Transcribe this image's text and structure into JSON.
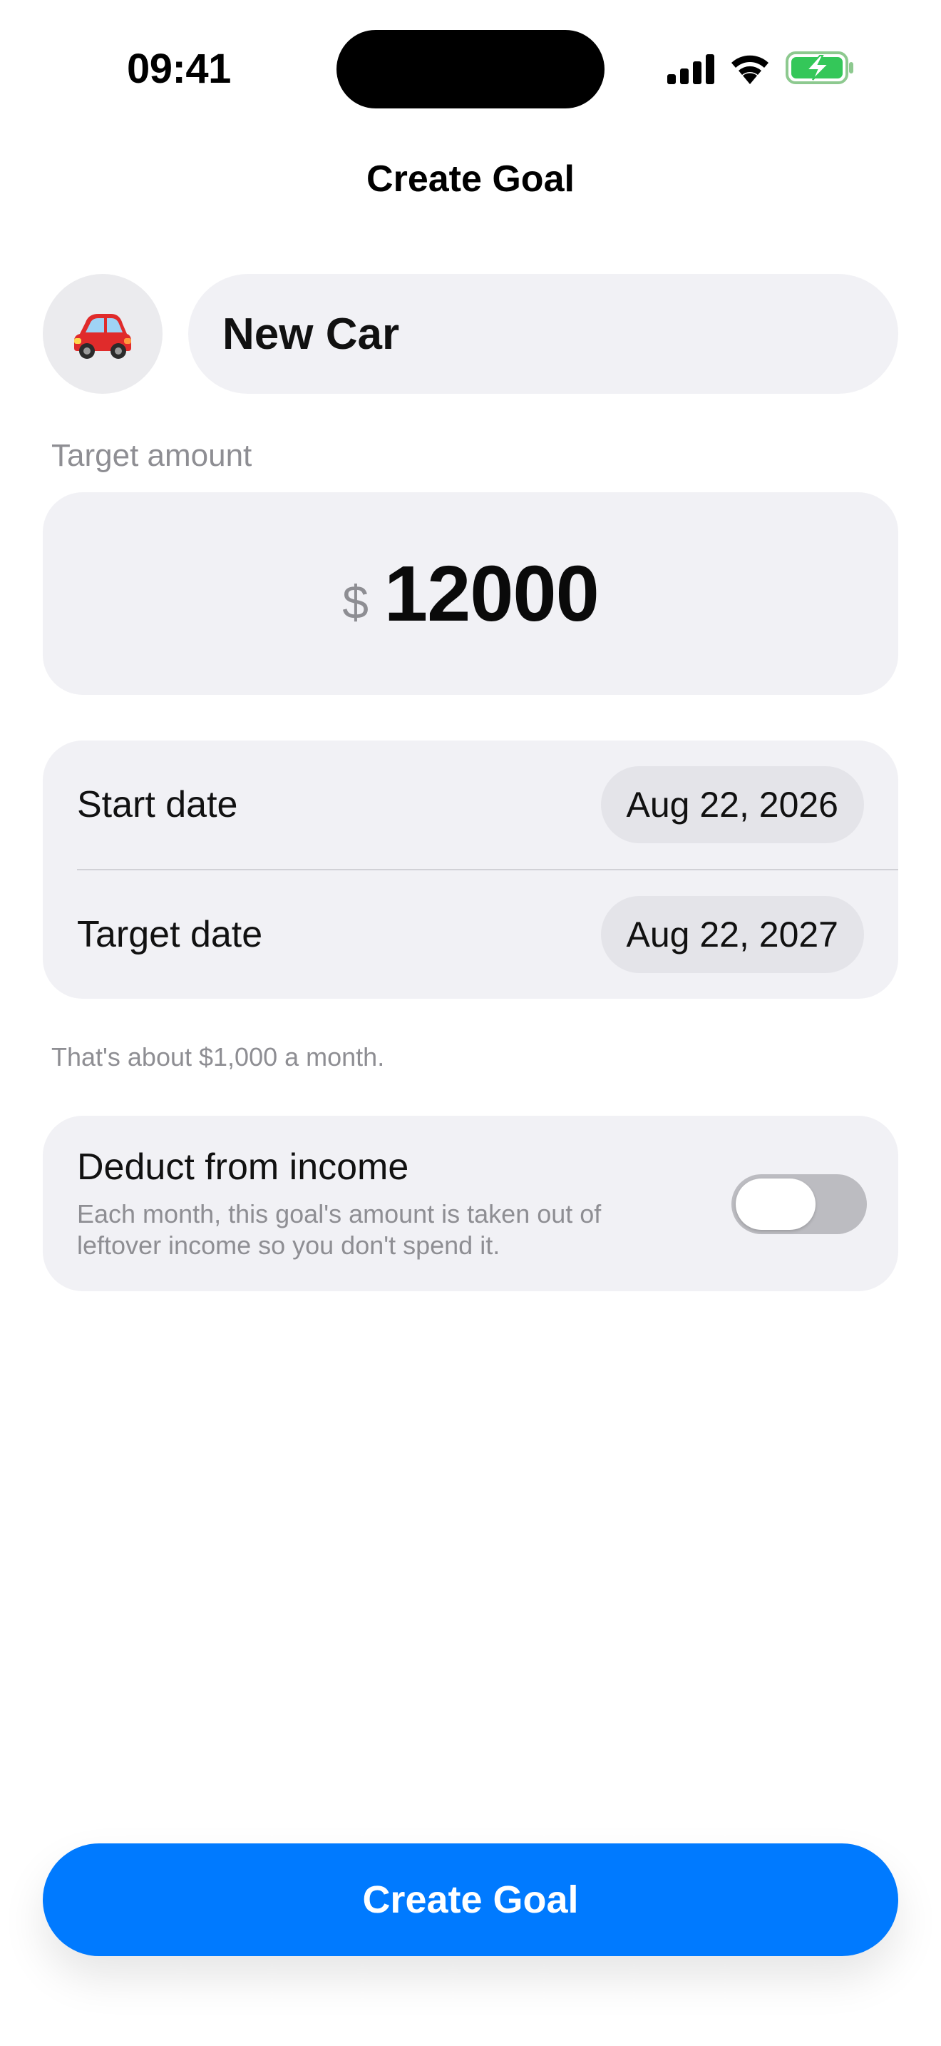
{
  "status_bar": {
    "time": "09:41"
  },
  "nav": {
    "title": "Create Goal"
  },
  "goal": {
    "emoji_icon": "red-car",
    "name": "New Car"
  },
  "amount": {
    "label": "Target amount",
    "currency": "$",
    "value": "12000"
  },
  "dates": {
    "start_label": "Start date",
    "start_value": "Aug 22, 2026",
    "target_label": "Target date",
    "target_value": "Aug 22, 2027"
  },
  "monthly_hint": "That's about $1,000 a month.",
  "deduct": {
    "title": "Deduct from income",
    "description": "Each month, this goal's amount is taken out of leftover income so you don't spend it.",
    "enabled": false
  },
  "primary_action": {
    "label": "Create Goal"
  },
  "colors": {
    "accent": "#007aff",
    "battery": "#34c759",
    "card": "#f1f1f5"
  }
}
